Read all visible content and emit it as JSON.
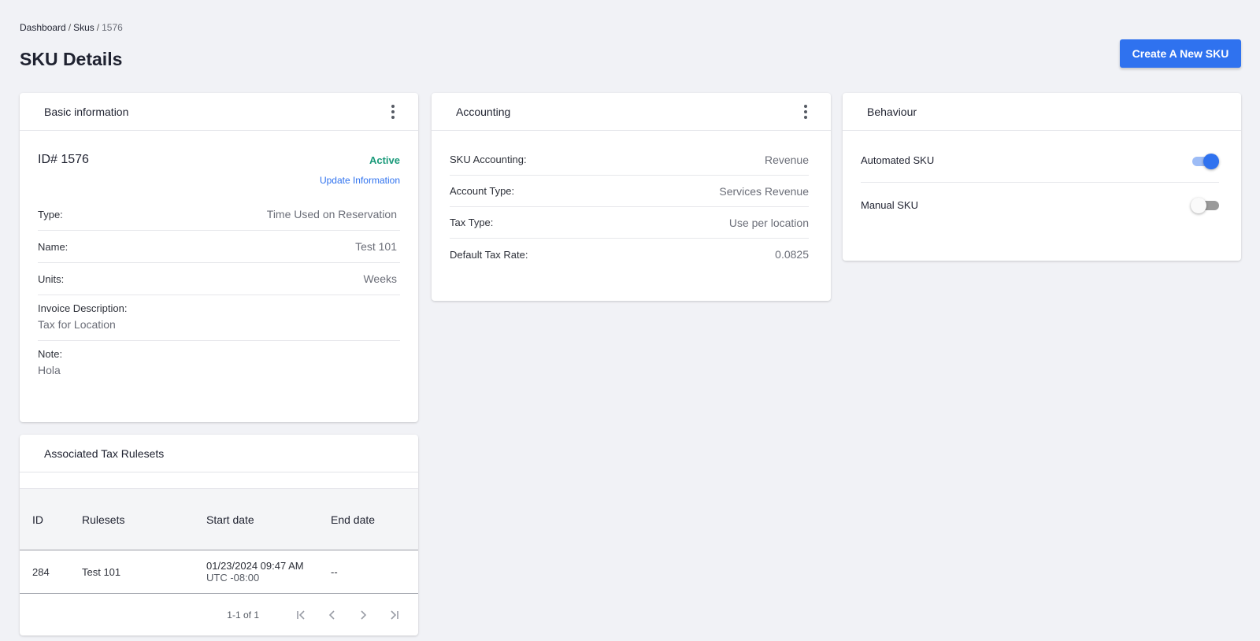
{
  "breadcrumb": {
    "items": [
      "Dashboard",
      "Skus"
    ],
    "current": "1576",
    "separator": "/"
  },
  "page": {
    "title": "SKU Details",
    "create_button": "Create A New SKU"
  },
  "basic": {
    "header": "Basic information",
    "id_label": "ID# 1576",
    "status": "Active",
    "update_link": "Update Information",
    "rows": [
      {
        "label": "Type:",
        "value": "Time Used on Reservation"
      },
      {
        "label": "Name:",
        "value": "Test 101"
      },
      {
        "label": "Units:",
        "value": "Weeks"
      }
    ],
    "invoice": {
      "label": "Invoice Description:",
      "value": "Tax for Location"
    },
    "note": {
      "label": "Note:",
      "value": "Hola"
    }
  },
  "accounting": {
    "header": "Accounting",
    "rows": [
      {
        "label": "SKU Accounting:",
        "value": "Revenue"
      },
      {
        "label": "Account Type:",
        "value": "Services Revenue"
      },
      {
        "label": "Tax Type:",
        "value": "Use per location"
      },
      {
        "label": "Default Tax Rate:",
        "value": "0.0825"
      }
    ]
  },
  "behaviour": {
    "header": "Behaviour",
    "rows": [
      {
        "label": "Automated SKU",
        "enabled": true
      },
      {
        "label": "Manual SKU",
        "enabled": false
      }
    ]
  },
  "tax": {
    "header": "Associated Tax Rulesets",
    "columns": [
      "ID",
      "Rulesets",
      "Start date",
      "End date"
    ],
    "rows": [
      {
        "id": "284",
        "ruleset": "Test 101",
        "start_date": "01/23/2024 09:47 AM",
        "start_tz": "UTC -08:00",
        "end_date": "--"
      }
    ],
    "pagination": {
      "range": "1-1 of 1"
    }
  },
  "colors": {
    "accent": "#2f72ef",
    "active": "#1a9a7a",
    "background": "#f1f2f6"
  }
}
